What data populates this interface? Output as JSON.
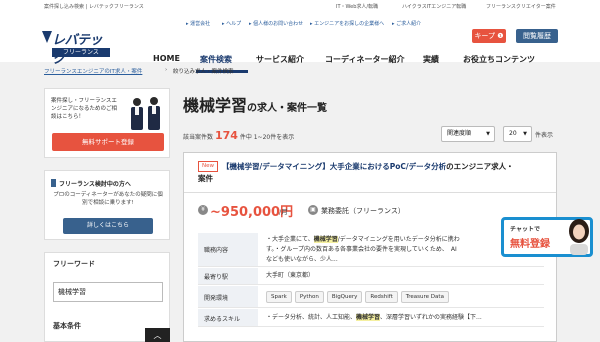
{
  "topbar": {
    "left": "案件探し込み検索 | レバテックフリーランス",
    "links": [
      "IT・Web求人/転職",
      "ハイクラスITエンジニア転職",
      "フリーランスクリエイター案件"
    ]
  },
  "header": {
    "logo_main": "レバテック",
    "logo_sub": "フリーランス",
    "util_links": [
      "運営会社",
      "ヘルプ",
      "個人様のお問い合わせ",
      "エンジニアをお探しの企業様へ",
      "ご求人紹介"
    ],
    "keep_label": "キープ",
    "history_label": "閲覧履歴"
  },
  "nav": {
    "items": [
      "HOME",
      "案件検索",
      "サービス紹介",
      "コーディネーター紹介",
      "実績",
      "お役立ちコンテンツ"
    ]
  },
  "breadcrumb": {
    "link": "フリーランスエンジニアのIT求人・案件",
    "current": "絞り込み求人・案件検索"
  },
  "sidebar": {
    "promo_text": "案件探し・フリーランスエンジニアになるためのご相談はこちら！",
    "promo_button": "無料サポート登録",
    "consult_title": "フリーランス検討中の方へ",
    "consult_desc": "プロのコーディネーターがあなたの疑問に個別で相談に乗ります!",
    "consult_button": "詳しくはこちら",
    "freeword_title": "フリーワード",
    "freeword_value": "機械学習",
    "conditions_title": "基本条件",
    "scroll_top": "︿"
  },
  "main": {
    "title": "機械学習",
    "title_suffix": "の求人・案件一覧",
    "count_prefix": "該当案件数",
    "count": "174",
    "count_suffix": "件中 1~20件を表示",
    "sort_value": "関連度順",
    "per_page_value": "20",
    "per_page_suffix": "件表示"
  },
  "job": {
    "badge": "New",
    "title": "【機械学習/データマイニング】大手企業におけるPoC/データ分析",
    "title_suffix": "のエンジニア求人・",
    "title_line2": "案件",
    "price": "~950,000円",
    "per_month": "/月",
    "contract": "業務委託（フリーランス）",
    "rows": [
      {
        "label": "職務内容",
        "line1_a": "・大手企業にて、",
        "line1_hl": "機械学習",
        "line1_b": "/データマイニングを用いたデータ分析に携わ",
        "line2": "す。・グループ内の数百ある各事業会社の要件を実現していくため、　AI",
        "line3": "なども使いながら、少人..."
      },
      {
        "label": "最寄り駅",
        "value": "大手町（東京都）"
      },
      {
        "label": "開発環境",
        "tags": [
          "Spark",
          "Python",
          "BigQuery",
          "Redshift",
          "Treasure Data"
        ]
      },
      {
        "label": "求めるスキル",
        "value_a": "・データ分析、統計、人工知能、",
        "value_hl": "機械学習",
        "value_b": "、深層学習いずれかの実務経験【下..."
      }
    ]
  },
  "chat": {
    "small": "チャットで",
    "large": "無料登録"
  },
  "colors": {
    "brand_navy": "#1a3a6e",
    "accent_red": "#e7533f",
    "button_blue": "#38618d",
    "chat_border": "#1a8fd0"
  }
}
